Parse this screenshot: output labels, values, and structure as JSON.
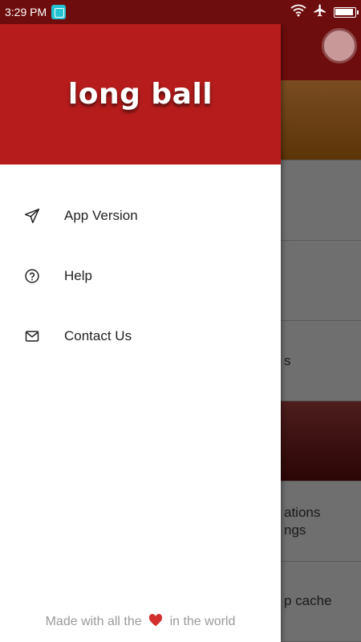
{
  "status_bar": {
    "time": "3:29 PM",
    "battery_level": 0.95
  },
  "drawer": {
    "app_title": "long ball",
    "menu": [
      {
        "label": "App Version",
        "icon": "send-icon"
      },
      {
        "label": "Help",
        "icon": "help-circle-icon"
      },
      {
        "label": "Contact Us",
        "icon": "mail-icon"
      }
    ],
    "footer": {
      "prefix": "Made with all the",
      "suffix": "in the world",
      "icon": "heart-icon"
    }
  },
  "background": {
    "partial_texts": [
      "s",
      "ations",
      "ngs",
      "p cache"
    ]
  },
  "colors": {
    "header": "#b71c1c",
    "status_bar": "#6e0d0d",
    "heart": "#d32f2f"
  }
}
